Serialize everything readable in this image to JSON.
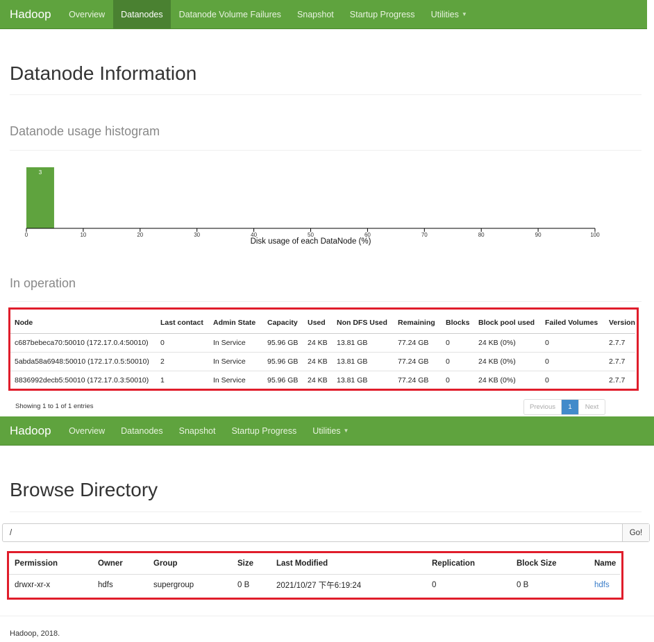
{
  "top_nav": {
    "brand": "Hadoop",
    "items": [
      {
        "label": "Overview",
        "active": false
      },
      {
        "label": "Datanodes",
        "active": true
      },
      {
        "label": "Datanode Volume Failures",
        "active": false
      },
      {
        "label": "Snapshot",
        "active": false
      },
      {
        "label": "Startup Progress",
        "active": false
      },
      {
        "label": "Utilities",
        "active": false,
        "dropdown": true
      }
    ]
  },
  "datanode_page": {
    "title": "Datanode Information",
    "histogram_heading": "Datanode usage histogram",
    "in_operation_heading": "In operation"
  },
  "chart_data": {
    "type": "bar",
    "xlabel": "Disk usage of each DataNode (%)",
    "xlim": [
      0,
      100
    ],
    "xticks": [
      0,
      10,
      20,
      30,
      40,
      50,
      60,
      70,
      80,
      90,
      100
    ],
    "bins": [
      {
        "x0": 0,
        "x1": 5,
        "count": 3
      }
    ],
    "color": "#5fa33e"
  },
  "datanode_table": {
    "columns": [
      "Node",
      "Last contact",
      "Admin State",
      "Capacity",
      "Used",
      "Non DFS Used",
      "Remaining",
      "Blocks",
      "Block pool used",
      "Failed Volumes",
      "Version"
    ],
    "rows": [
      [
        "c687bebeca70:50010 (172.17.0.4:50010)",
        "0",
        "In Service",
        "95.96 GB",
        "24 KB",
        "13.81 GB",
        "77.24 GB",
        "0",
        "24 KB (0%)",
        "0",
        "2.7.7"
      ],
      [
        "5abda58a6948:50010 (172.17.0.5:50010)",
        "2",
        "In Service",
        "95.96 GB",
        "24 KB",
        "13.81 GB",
        "77.24 GB",
        "0",
        "24 KB (0%)",
        "0",
        "2.7.7"
      ],
      [
        "8836992decb5:50010 (172.17.0.3:50010)",
        "1",
        "In Service",
        "95.96 GB",
        "24 KB",
        "13.81 GB",
        "77.24 GB",
        "0",
        "24 KB (0%)",
        "0",
        "2.7.7"
      ]
    ],
    "showing": "Showing 1 to 1 of 1 entries",
    "pager": {
      "prev": "Previous",
      "current": "1",
      "next": "Next"
    }
  },
  "bottom_nav": {
    "brand": "Hadoop",
    "items": [
      {
        "label": "Overview"
      },
      {
        "label": "Datanodes"
      },
      {
        "label": "Snapshot"
      },
      {
        "label": "Startup Progress"
      },
      {
        "label": "Utilities",
        "dropdown": true
      }
    ]
  },
  "browse_page": {
    "title": "Browse Directory",
    "path_value": "/",
    "go_label": "Go!"
  },
  "browse_table": {
    "columns": [
      "Permission",
      "Owner",
      "Group",
      "Size",
      "Last Modified",
      "Replication",
      "Block Size",
      "Name"
    ],
    "rows": [
      [
        "drwxr-xr-x",
        "hdfs",
        "supergroup",
        "0 B",
        "2021/10/27 下午6:19:24",
        "0",
        "0 B",
        "hdfs"
      ]
    ]
  },
  "footer": "Hadoop, 2018."
}
